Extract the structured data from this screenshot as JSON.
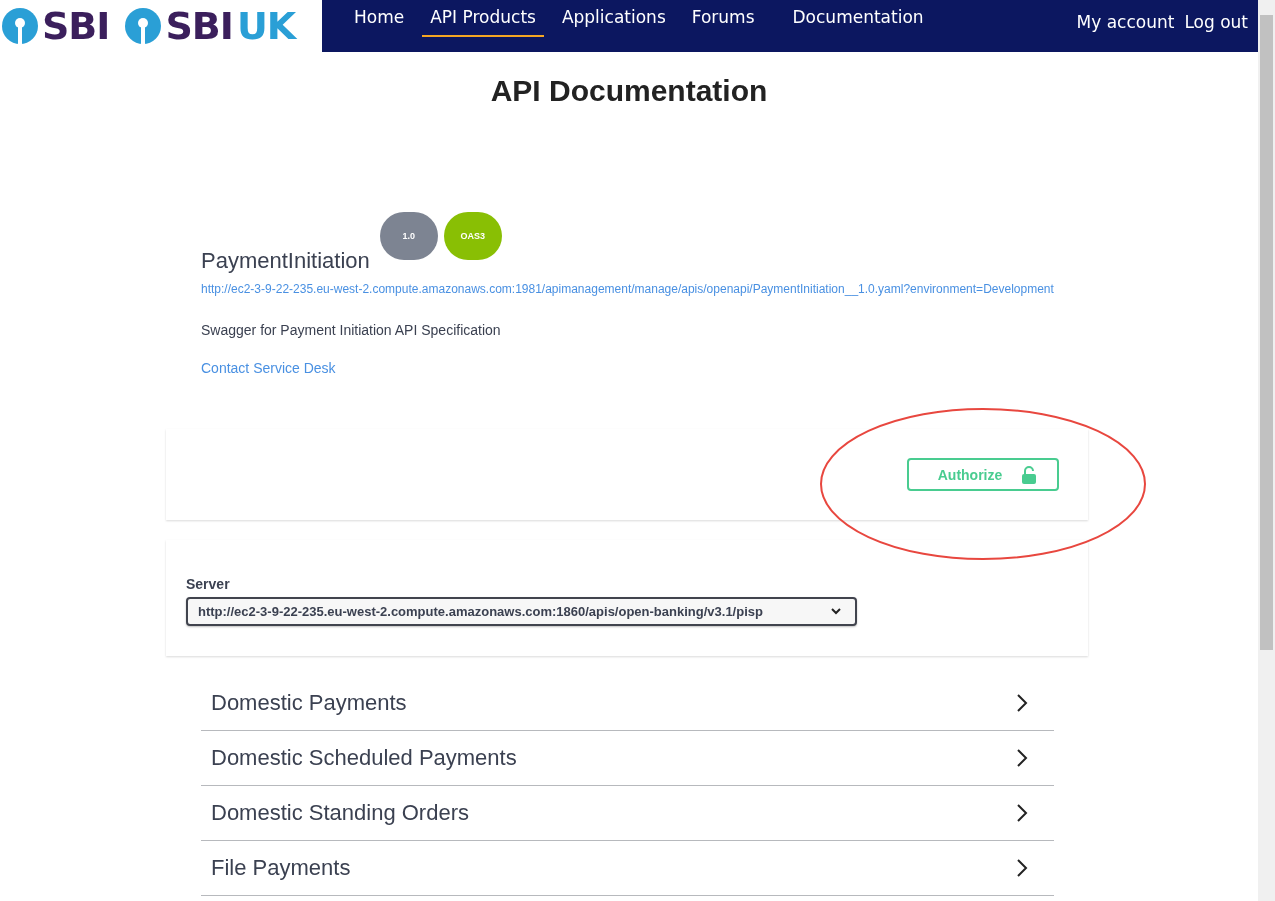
{
  "header": {
    "logo": [
      "SBI",
      "SBI",
      "UK"
    ],
    "nav": [
      {
        "label": "Home",
        "selected": false
      },
      {
        "label": "API Products",
        "selected": true
      },
      {
        "label": "Applications",
        "selected": false
      },
      {
        "label": "Forums",
        "selected": false
      },
      {
        "label": "Documentation",
        "selected": false
      }
    ],
    "account_links": [
      "My account",
      "Log out"
    ]
  },
  "page_title": "API Documentation",
  "api_info": {
    "tags": [
      {
        "label": "1.0",
        "color": "#7d8492"
      },
      {
        "label": "OAS3",
        "color": "#89bf04"
      }
    ],
    "title": "PaymentInitiation",
    "spec_url": "http://ec2-3-9-22-235.eu-west-2.compute.amazonaws.com:1981/apimanagement/manage/apis/openapi/PaymentInitiation__1.0.yaml?environment=Development",
    "description": "Swagger for Payment Initiation API Specification",
    "contact_link": "Contact Service Desk"
  },
  "authorize_button": {
    "label": "Authorize",
    "highlighted": true
  },
  "servers": {
    "label": "Server",
    "value": "http://ec2-3-9-22-235.eu-west-2.compute.amazonaws.com:1860/apis/open-banking/v3.1/pisp"
  },
  "sections": [
    {
      "title": "Domestic Payments",
      "expanded": false
    },
    {
      "title": "Domestic Scheduled Payments",
      "expanded": false
    },
    {
      "title": "Domestic Standing Orders",
      "expanded": false
    },
    {
      "title": "File Payments",
      "expanded": false
    }
  ]
}
